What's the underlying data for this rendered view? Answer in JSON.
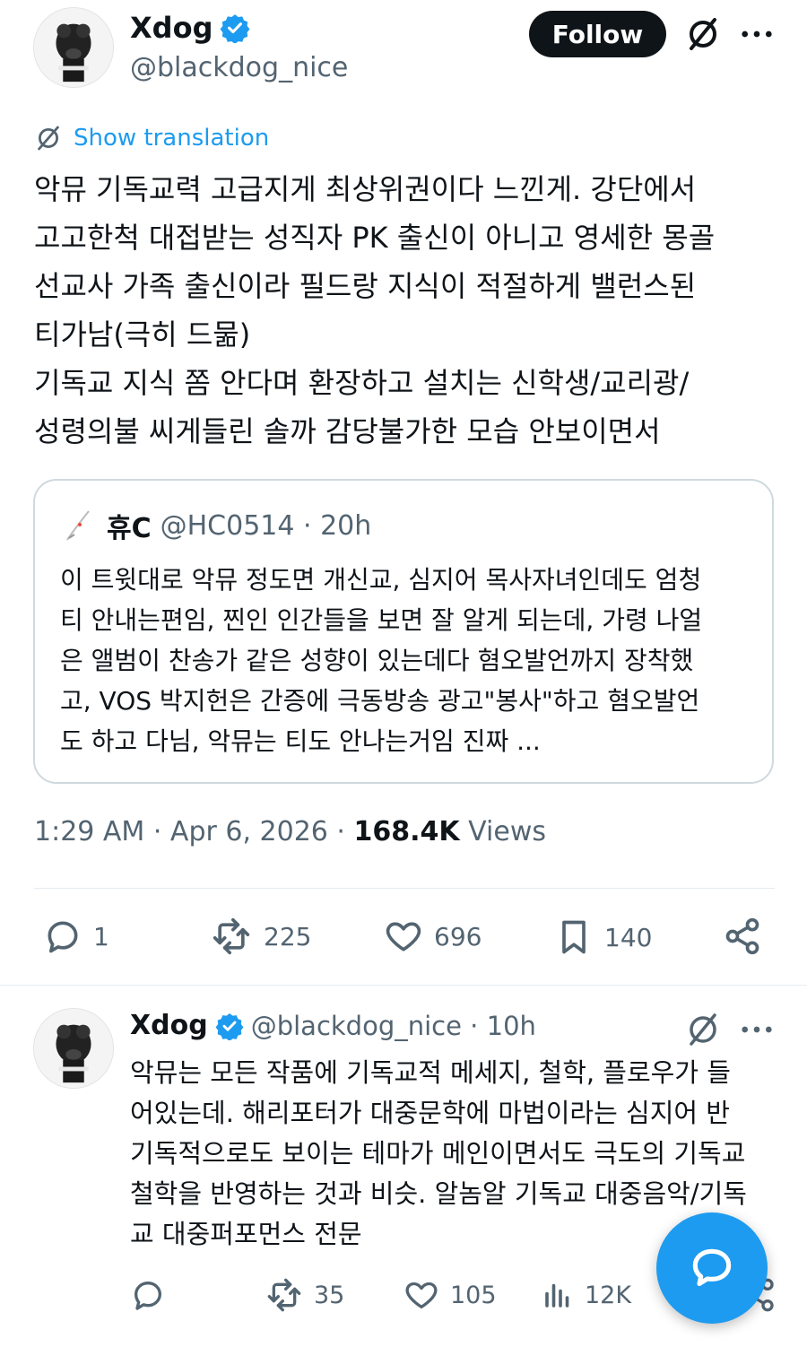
{
  "main_tweet": {
    "author": {
      "name": "Xdog",
      "handle": "@blackdog_nice"
    },
    "follow_label": "Follow",
    "show_translation_label": "Show translation",
    "text_lines": [
      "악뮤 기독교력 고급지게 최상위권이다 느낀게. 강단에서",
      "고고한척 대접받는 성직자 PK 출신이 아니고 영세한 몽골",
      "선교사 가족 출신이라 필드랑 지식이 적절하게 밸런스된",
      "티가남(극히 드묾)",
      "기독교 지식 쫌 안다며 환장하고 설치는 신학생/교리광/",
      "성령의불 씨게들린 솔까 감당불가한 모습 안보이면서"
    ],
    "quote": {
      "name": "휴C",
      "meta": "@HC0514 · 20h",
      "text_lines": [
        "이 트윗대로 악뮤 정도면 개신교, 심지어 목사자녀인데도 엄청",
        "티 안내는편임, 찐인 인간들을 보면 잘 알게 되는데, 가령 나얼",
        "은 앨범이 찬송가 같은 성향이 있는데다 혐오발언까지 장착했",
        "고, VOS 박지헌은 간증에 극동방송 광고\"봉사\"하고 혐오발언",
        "도 하고 다님, 악뮤는 티도 안나는거임 진짜 ..."
      ]
    },
    "timestamp": "1:29 AM · Apr 6, 2026 · ",
    "views_count": "168.4K",
    "views_label": "Views",
    "stats": {
      "replies": "1",
      "reposts": "225",
      "likes": "696",
      "bookmarks": "140"
    }
  },
  "reply_tweet": {
    "author": {
      "name": "Xdog",
      "handle": "@blackdog_nice",
      "age": " · 10h"
    },
    "text_lines": [
      "악뮤는 모든 작품에 기독교적 메세지, 철학, 플로우가 들",
      "어있는데. 해리포터가 대중문학에 마법이라는 심지어 반",
      "기독적으로도 보이는 테마가 메인이면서도 극도의 기독교",
      "철학을 반영하는 것과 비슷. 알놈알 기독교 대중음악/기독",
      "교 대중퍼포먼스 전문"
    ],
    "stats": {
      "reposts": "35",
      "likes": "105",
      "views": "12K"
    }
  },
  "colors": {
    "accent": "#1d9bf0",
    "text": "#0f1419",
    "muted": "#536471",
    "border": "#cfd9de"
  }
}
